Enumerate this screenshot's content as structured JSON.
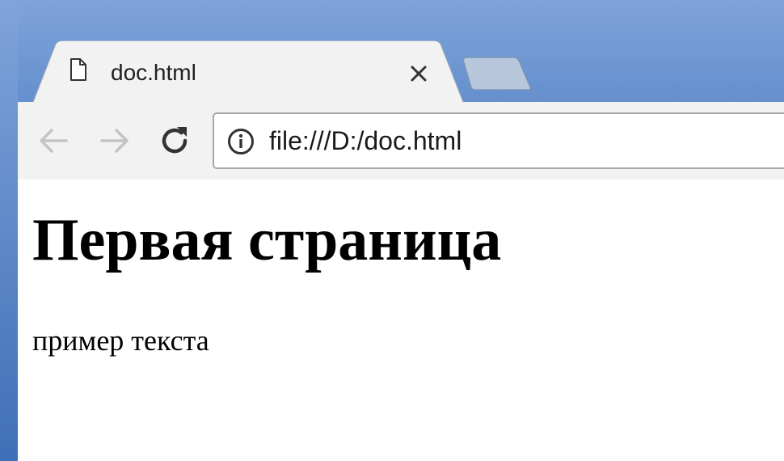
{
  "tab": {
    "title": "doc.html",
    "icon": "document-icon",
    "close_icon": "close-icon"
  },
  "toolbar": {
    "back_icon": "back-arrow-icon",
    "forward_icon": "forward-arrow-icon",
    "reload_icon": "reload-icon",
    "site_info_icon": "info-icon",
    "url": "file:///D:/doc.html"
  },
  "page": {
    "heading": "Первая страница",
    "paragraph": "пример текста"
  },
  "colors": {
    "frame_blue": "#4f7fc3",
    "toolbar_gray": "#f2f2f2",
    "disabled_arrow": "#c4c4c4"
  }
}
